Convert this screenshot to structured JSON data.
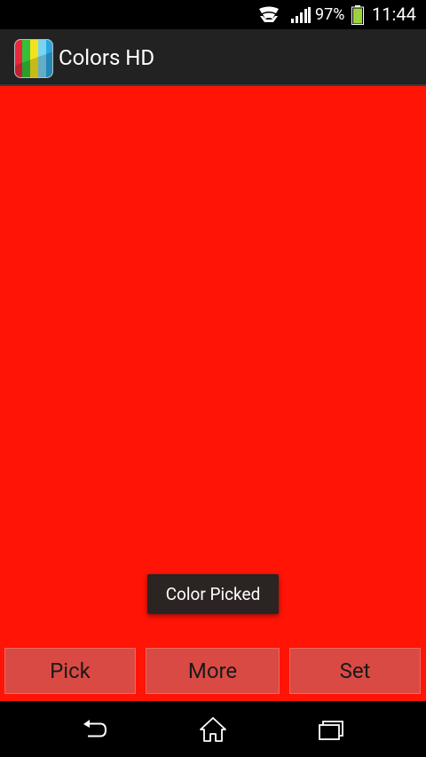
{
  "status_bar": {
    "battery_percent": "97%",
    "time": "11:44",
    "icons": [
      "wifi-icon",
      "signal-icon",
      "battery-icon"
    ]
  },
  "action_bar": {
    "title": "Colors HD",
    "icon": "app-icon"
  },
  "content": {
    "picked_color": "#ff1406",
    "toast": "Color Picked"
  },
  "buttons": {
    "pick": "Pick",
    "more": "More",
    "set": "Set"
  },
  "nav_bar": {
    "icons": [
      "back-icon",
      "home-icon",
      "recent-apps-icon"
    ]
  },
  "colors": {
    "button_bg": "#d94a44",
    "action_bar_bg": "#222222",
    "toast_bg": "#2b2423"
  }
}
